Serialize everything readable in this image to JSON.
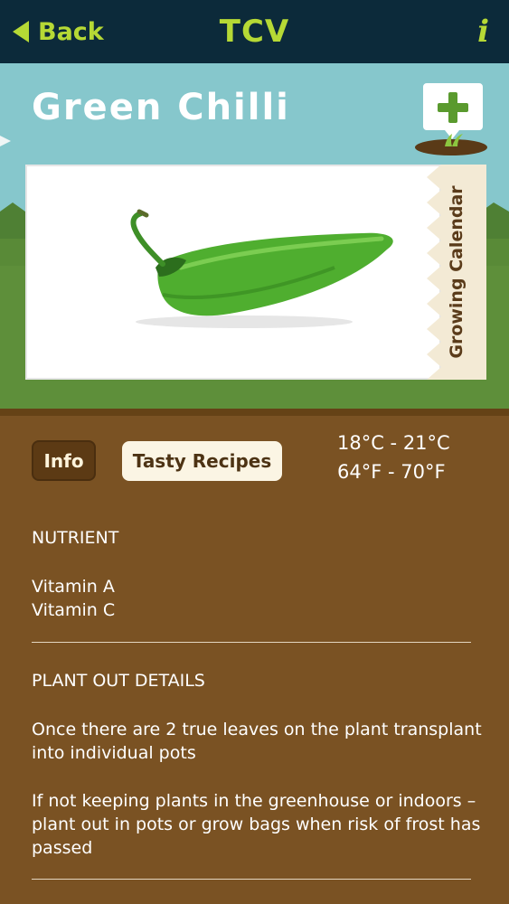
{
  "nav": {
    "back_label": "Back",
    "title": "TCV",
    "info_label": "i"
  },
  "hero": {
    "plant_name": "Green Chilli",
    "calendar_tab_label": "Growing Calendar",
    "add_icon": "plus-icon"
  },
  "tabs": {
    "info_label": "Info",
    "recipes_label": "Tasty Recipes",
    "active": "Info"
  },
  "temperature": {
    "celsius": "18°C - 21°C",
    "fahrenheit": "64°F - 70°F"
  },
  "sections": {
    "nutrient": {
      "heading": "NUTRIENT",
      "items": [
        "Vitamin A",
        "Vitamin C"
      ]
    },
    "plant_out": {
      "heading": "PLANT OUT DETAILS",
      "para1_line1": "Once there are 2 true leaves on the plant transplant",
      "para1_line2": "into individual pots",
      "para2_line1": "If not keeping plants in the greenhouse or indoors –",
      "para2_line2": "plant out in pots or grow bags when risk of frost has",
      "para2_line3": "passed"
    }
  },
  "colors": {
    "nav_bg": "#0c2a3a",
    "accent": "#b6d935",
    "sky": "#86c7cc",
    "grass": "#5e8f3a",
    "soil": "#7a5223"
  }
}
